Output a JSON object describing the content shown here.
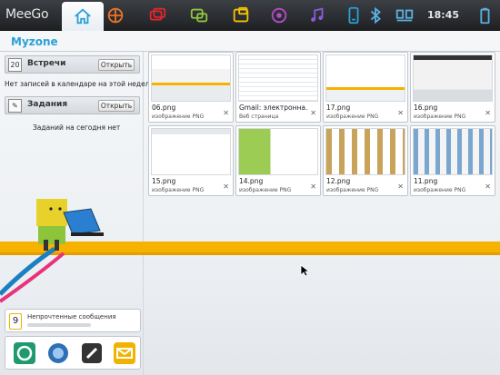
{
  "topbar": {
    "brand": "MeeGo",
    "tabs": [
      {
        "icon": "home-icon",
        "active": true
      },
      {
        "icon": "zones-icon"
      },
      {
        "icon": "status-icon"
      },
      {
        "icon": "people-icon"
      },
      {
        "icon": "web-icon"
      },
      {
        "icon": "pasteboard-icon"
      },
      {
        "icon": "music-icon"
      },
      {
        "icon": "devices-icon"
      },
      {
        "icon": "bluetooth-icon"
      },
      {
        "icon": "battery-icon"
      },
      {
        "icon": "display-icon"
      }
    ],
    "clock": "18:45"
  },
  "page": {
    "title": "Myzone"
  },
  "left": {
    "appointments": {
      "label": "Встречи",
      "day": "20",
      "open": "Открыть",
      "empty": "Нет записей в календаре на этой неделе"
    },
    "tasks": {
      "label": "Задания",
      "open": "Открыть",
      "empty": "Заданий на сегодня нет"
    },
    "notifications": {
      "count": "9",
      "label": "Непрочтенные сообщения"
    },
    "dock_apps": [
      "chat-app-icon",
      "browser-app-icon",
      "settings-app-icon",
      "email-app-icon"
    ]
  },
  "thumbnails": [
    {
      "name": "06.png",
      "type": "изображение PNG"
    },
    {
      "name": "Gmail: электронна...",
      "type": "Веб страница"
    },
    {
      "name": "17.png",
      "type": "изображение PNG"
    },
    {
      "name": "16.png",
      "type": "изображение PNG"
    },
    {
      "name": "15.png",
      "type": "изображение PNG"
    },
    {
      "name": "14.png",
      "type": "изображение PNG"
    },
    {
      "name": "12.png",
      "type": "изображение PNG"
    },
    {
      "name": "11.png",
      "type": "изображение PNG"
    }
  ],
  "colors": {
    "accent": "#2aa1d6",
    "stripe": "#f7b200"
  }
}
